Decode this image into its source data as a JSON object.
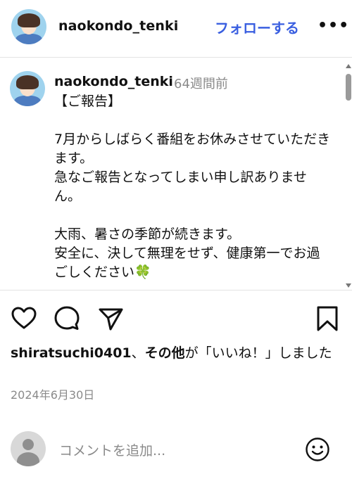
{
  "header": {
    "username": "naokondo_tenki",
    "follow_label": "フォローする",
    "more_label": "•••"
  },
  "caption": {
    "username": "naokondo_tenki",
    "time_ago": "64週間前",
    "text": "【ご報告】\n\n7月からしばらく番組をお休みさせていただきます。\n急なご報告となってしまい申し訳ありません。\n\n大雨、暑さの季節が続きます。\n安全に、決して無理をせず、健康第一でお過ごしください🍀"
  },
  "actions": {
    "icons": [
      "heart-icon",
      "comment-icon",
      "share-icon",
      "bookmark-icon"
    ]
  },
  "likes": {
    "user": "shiratsuchi0401",
    "separator": "、",
    "others": "その他",
    "suffix": "が「いいね！」しました"
  },
  "post_date": "2024年6月30日",
  "comment": {
    "placeholder": "コメントを追加..."
  },
  "colors": {
    "accent": "#3a5fe0",
    "muted": "#8a8a8a"
  }
}
